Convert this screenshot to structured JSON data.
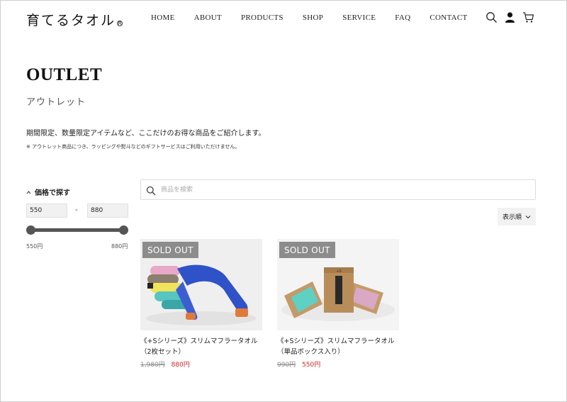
{
  "header": {
    "logo": "育てるタオル",
    "logo_mark": "R",
    "nav": [
      "HOME",
      "ABOUT",
      "PRODUCTS",
      "SHOP",
      "SERVICE",
      "FAQ",
      "CONTACT"
    ],
    "icons": [
      "search-icon",
      "account-icon",
      "cart-icon"
    ]
  },
  "page": {
    "title": "OUTLET",
    "subtitle": "アウトレット",
    "description": "期間限定、数量限定アイテムなど、ここだけのお得な商品をご紹介します。",
    "note": "※ アウトレット商品につき、ラッピングや熨斗などのギフトサービスはご利用いただけません。"
  },
  "filter": {
    "heading": "価格で探す",
    "min_value": "550",
    "max_value": "880",
    "dash": "-",
    "min_label": "550円",
    "max_label": "880円"
  },
  "search": {
    "placeholder": "商品を検索",
    "value": ""
  },
  "sort": {
    "label": "表示順"
  },
  "products": [
    {
      "badge": "SOLD OUT",
      "name": "《+Sシリーズ》スリムマフラータオル（2枚セット）",
      "old_price": "1,980円",
      "price": "880円"
    },
    {
      "badge": "SOLD OUT",
      "name": "《+Sシリーズ》スリムマフラータオル（単品ボックス入り）",
      "old_price": "990円",
      "price": "550円"
    }
  ],
  "colors": {
    "accent_price": "#d21f1f",
    "badge_bg": "#8c8c8c",
    "slider": "#555555"
  }
}
